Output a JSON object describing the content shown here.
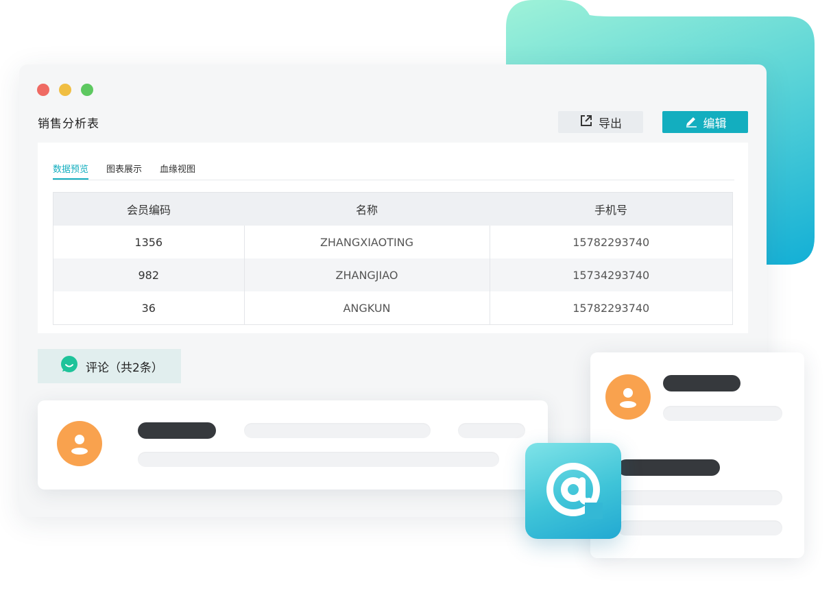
{
  "window": {
    "title": "销售分析表",
    "export_label": "导出",
    "edit_label": "编辑"
  },
  "tabs": [
    {
      "label": "数据预览",
      "active": true
    },
    {
      "label": "图表展示",
      "active": false
    },
    {
      "label": "血缘视图",
      "active": false
    }
  ],
  "table": {
    "headers": [
      "会员编码",
      "名称",
      "手机号"
    ],
    "rows": [
      [
        "1356",
        "ZHANGXIAOTING",
        "15782293740"
      ],
      [
        "982",
        "ZHANGJIAO",
        "15734293740"
      ],
      [
        "36",
        "ANGKUN",
        "15782293740"
      ]
    ]
  },
  "comments": {
    "tab_label": "评论（共2条）"
  },
  "icons": {
    "export": "external-link-icon",
    "edit": "pencil-icon",
    "comment": "chat-bubble-icon",
    "mention": "at-sign-icon",
    "avatar": "user-icon"
  },
  "colors": {
    "accent": "#13aebf",
    "avatar": "#f9a24e",
    "traffic_red": "#ef6a63",
    "traffic_yellow": "#f0be42",
    "traffic_green": "#5dc860"
  }
}
